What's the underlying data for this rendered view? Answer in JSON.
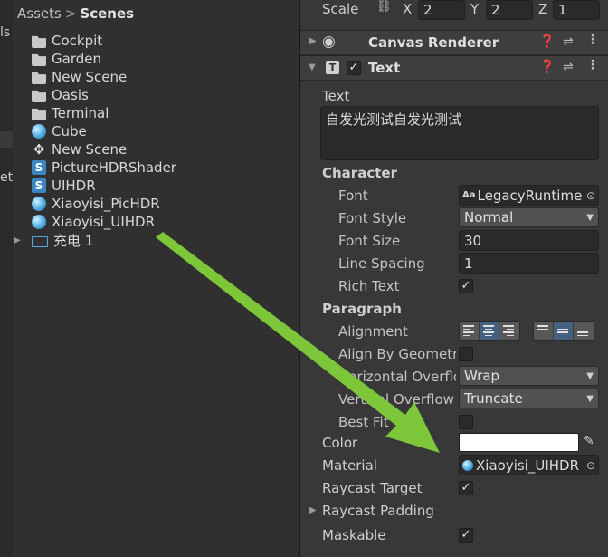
{
  "project": {
    "breadcrumb": {
      "root": "Assets",
      "separator": ">",
      "current": "Scenes"
    },
    "items": [
      {
        "icon": "folder-icon",
        "label": "Cockpit"
      },
      {
        "icon": "folder-icon",
        "label": "Garden"
      },
      {
        "icon": "folder-icon",
        "label": "New Scene"
      },
      {
        "icon": "folder-icon",
        "label": "Oasis"
      },
      {
        "icon": "folder-icon",
        "label": "Terminal"
      },
      {
        "icon": "material-sphere-icon",
        "label": "Cube"
      },
      {
        "icon": "unity-scene-icon",
        "label": "New Scene"
      },
      {
        "icon": "shader-icon",
        "label": "PictureHDRShader"
      },
      {
        "icon": "shader-icon",
        "label": "UIHDR"
      },
      {
        "icon": "material-sphere-icon",
        "label": "Xiaoyisi_PicHDR"
      },
      {
        "icon": "material-sphere-icon",
        "label": "Xiaoyisi_UIHDR"
      },
      {
        "icon": "prefab-icon",
        "label": "充电 1"
      }
    ],
    "edge_fragments": [
      "ls",
      "et"
    ]
  },
  "inspector": {
    "scale": {
      "label": "Scale",
      "x_label": "X",
      "x": "2",
      "y_label": "Y",
      "y": "2",
      "z_label": "Z",
      "z": "1"
    },
    "canvas_renderer": {
      "title": "Canvas Renderer"
    },
    "text_component": {
      "title": "Text",
      "text_label": "Text",
      "text_value": "自发光测试自发光测试",
      "character_header": "Character",
      "font_label": "Font",
      "font_value": "LegacyRuntime",
      "font_prefix": "Aa",
      "font_style_label": "Font Style",
      "font_style_value": "Normal",
      "font_size_label": "Font Size",
      "font_size_value": "30",
      "line_spacing_label": "Line Spacing",
      "line_spacing_value": "1",
      "rich_text_label": "Rich Text",
      "rich_text_checked": true,
      "paragraph_header": "Paragraph",
      "alignment_label": "Alignment",
      "align_by_geometry_label": "Align By Geometry",
      "align_by_geometry_checked": false,
      "horizontal_overflow_label": "Horizontal Overflow",
      "horizontal_overflow_value": "Wrap",
      "vertical_overflow_label": "Vertical Overflow",
      "vertical_overflow_value": "Truncate",
      "best_fit_label": "Best Fit",
      "best_fit_checked": false,
      "color_label": "Color",
      "color_value": "#ffffff",
      "material_label": "Material",
      "material_value": "Xiaoyisi_UIHDR",
      "raycast_target_label": "Raycast Target",
      "raycast_target_checked": true,
      "raycast_padding_label": "Raycast Padding",
      "maskable_label": "Maskable",
      "maskable_checked": true
    }
  },
  "colors": {
    "arrow": "#7dc63a",
    "selection_blue": "#46607f"
  }
}
